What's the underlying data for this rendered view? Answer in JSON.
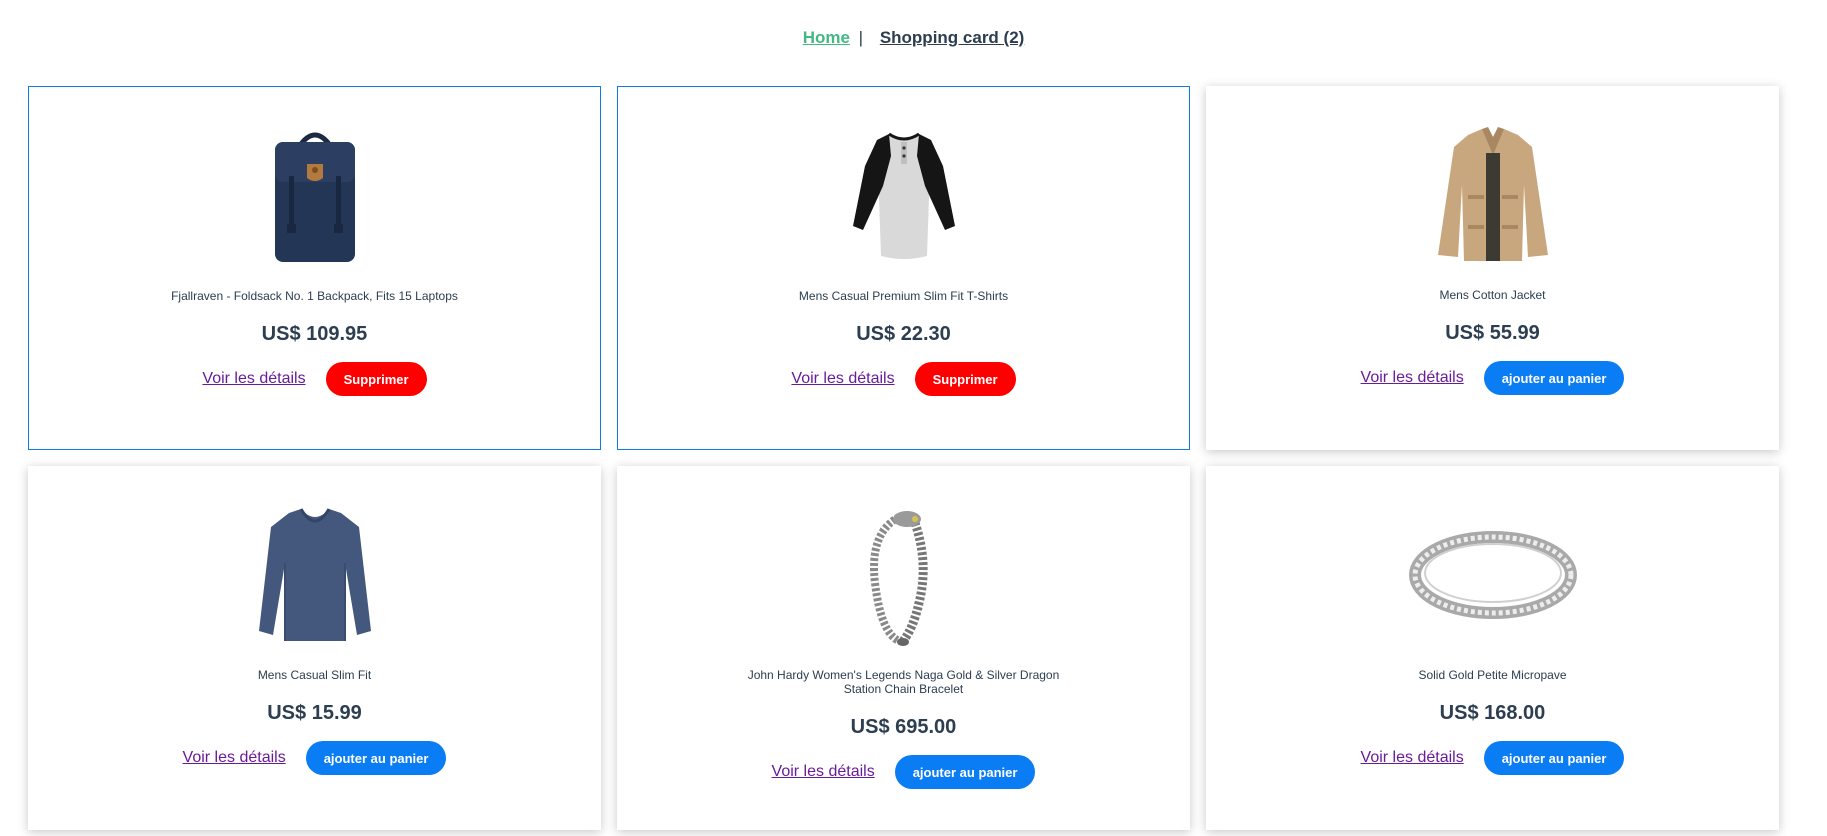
{
  "nav": {
    "home_label": "Home",
    "separator": "|",
    "cart_label": "Shopping card (2)"
  },
  "colors": {
    "accent_green": "#42b983",
    "remove_red": "#ff0000",
    "add_blue": "#0a7cf4",
    "in_cart_border": "#0d7de0"
  },
  "products": [
    {
      "title": "Fjallraven - Foldsack No. 1 Backpack, Fits 15 Laptops",
      "price": "US$ 109.95",
      "details_label": "Voir les détails",
      "action_label": "Supprimer",
      "in_cart": true,
      "image": "backpack"
    },
    {
      "title": "Mens Casual Premium Slim Fit T-Shirts",
      "price": "US$ 22.30",
      "details_label": "Voir les détails",
      "action_label": "Supprimer",
      "in_cart": true,
      "image": "raglan-tshirt"
    },
    {
      "title": "Mens Cotton Jacket",
      "price": "US$ 55.99",
      "details_label": "Voir les détails",
      "action_label": "ajouter au panier",
      "in_cart": false,
      "image": "cotton-jacket"
    },
    {
      "title": "Mens Casual Slim Fit",
      "price": "US$ 15.99",
      "details_label": "Voir les détails",
      "action_label": "ajouter au panier",
      "in_cart": false,
      "image": "long-sleeve-shirt"
    },
    {
      "title": "John Hardy Women's Legends Naga Gold & Silver Dragon Station Chain Bracelet",
      "price": "US$ 695.00",
      "details_label": "Voir les détails",
      "action_label": "ajouter au panier",
      "in_cart": false,
      "image": "chain-bracelet"
    },
    {
      "title": "Solid Gold Petite Micropave",
      "price": "US$ 168.00",
      "details_label": "Voir les détails",
      "action_label": "ajouter au panier",
      "in_cart": false,
      "image": "silver-ring"
    }
  ]
}
